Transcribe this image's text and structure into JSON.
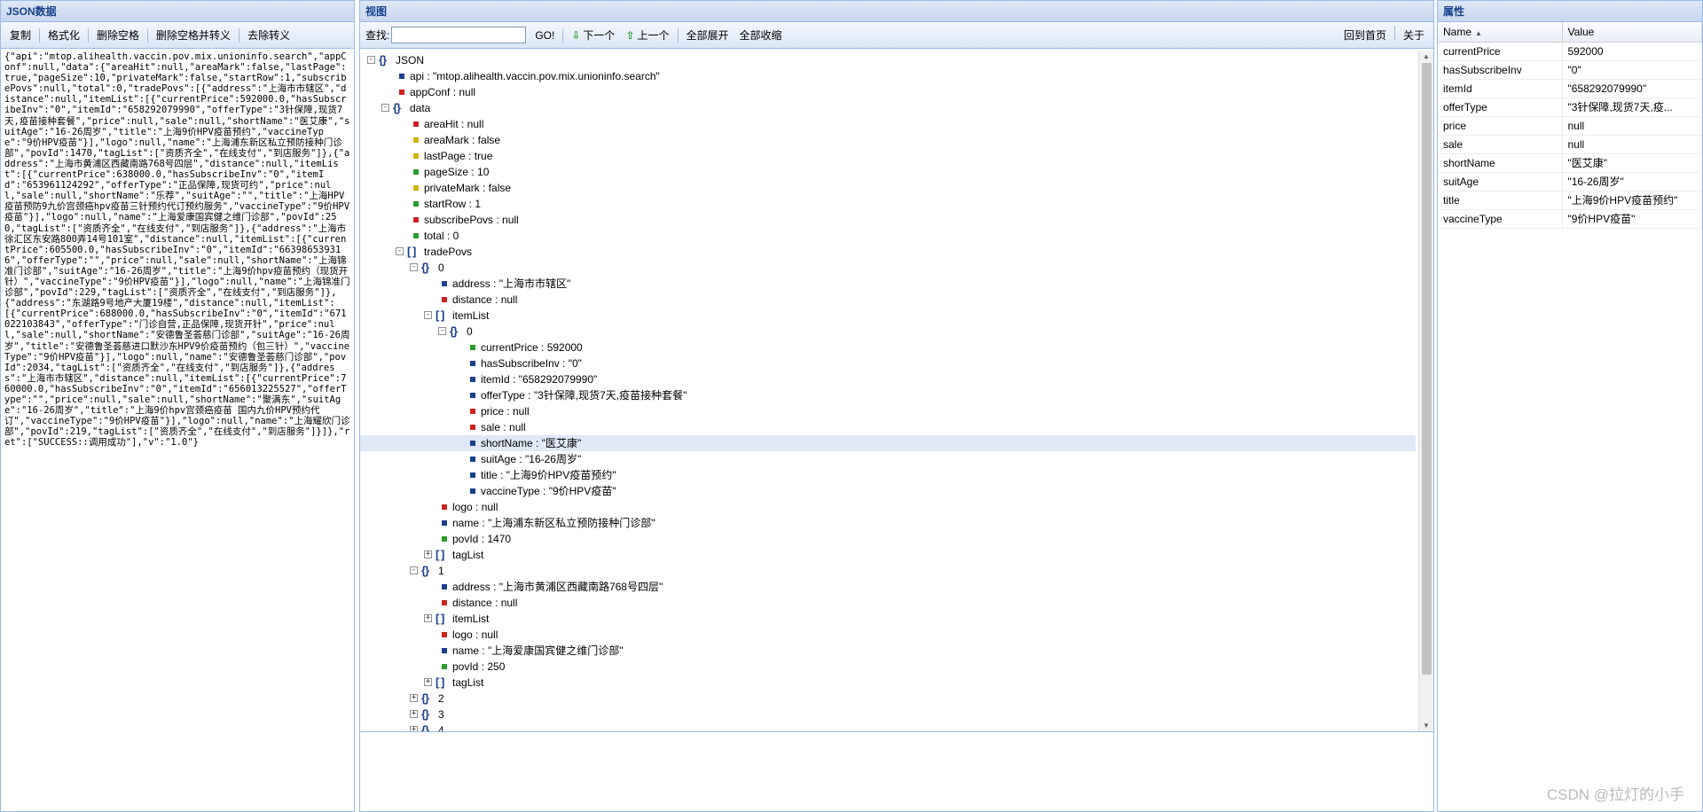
{
  "left_panel": {
    "title": "JSON数据",
    "toolbar": [
      "复制",
      "格式化",
      "删除空格",
      "删除空格并转义",
      "去除转义"
    ],
    "json_text": "{\"api\":\"mtop.alihealth.vaccin.pov.mix.unioninfo.search\",\"appConf\":null,\"data\":{\"areaHit\":null,\"areaMark\":false,\"lastPage\":true,\"pageSize\":10,\"privateMark\":false,\"startRow\":1,\"subscribePovs\":null,\"total\":0,\"tradePovs\":[{\"address\":\"上海市市辖区\",\"distance\":null,\"itemList\":[{\"currentPrice\":592000.0,\"hasSubscribeInv\":\"0\",\"itemId\":\"658292079990\",\"offerType\":\"3针保障,现货7天,疫苗接种套餐\",\"price\":null,\"sale\":null,\"shortName\":\"医艾康\",\"suitAge\":\"16-26周岁\",\"title\":\"上海9价HPV疫苗预约\",\"vaccineType\":\"9价HPV疫苗\"}],\"logo\":null,\"name\":\"上海浦东新区私立预防接种门诊部\",\"povId\":1470,\"tagList\":[\"资质齐全\",\"在线支付\",\"到店服务\"]},{\"address\":\"上海市黄浦区西藏南路768号四层\",\"distance\":null,\"itemList\":[{\"currentPrice\":638000.0,\"hasSubscribeInv\":\"0\",\"itemId\":\"653961124292\",\"offerType\":\"正品保障,现货可约\",\"price\":null,\"sale\":null,\"shortName\":\"乐荐\",\"suitAge\":\"\",\"title\":\"上海HPV疫苗预防9九价宫颈癌hpv疫苗三针预约代订预约服务\",\"vaccineType\":\"9价HPV疫苗\"}],\"logo\":null,\"name\":\"上海爱康国宾健之维门诊部\",\"povId\":250,\"tagList\":[\"资质齐全\",\"在线支付\",\"到店服务\"]},{\"address\":\"上海市徐汇区东安路800弄14号101室\",\"distance\":null,\"itemList\":[{\"currentPrice\":605500.0,\"hasSubscribeInv\":\"0\",\"itemId\":\"663986539316\",\"offerType\":\"\",\"price\":null,\"sale\":null,\"shortName\":\"上海锦准门诊部\",\"suitAge\":\"16-26周岁\",\"title\":\"上海9价hpv疫苗预约（现货开针）\",\"vaccineType\":\"9价HPV疫苗\"}],\"logo\":null,\"name\":\"上海锦准门诊部\",\"povId\":229,\"tagList\":[\"资质齐全\",\"在线支付\",\"到店服务\"]},{\"address\":\"东湖路9号地产大厦19楼\",\"distance\":null,\"itemList\":[{\"currentPrice\":688000.0,\"hasSubscribeInv\":\"0\",\"itemId\":\"671022103843\",\"offerType\":\"门诊自营,正品保障,现货开针\",\"price\":null,\"sale\":null,\"shortName\":\"安德鲁圣荟慈门诊部\",\"suitAge\":\"16-26周岁\",\"title\":\"安德鲁圣荟慈进口默沙东HPV9价疫苗预约（包三针）\",\"vaccineType\":\"9价HPV疫苗\"}],\"logo\":null,\"name\":\"安德鲁圣荟慈门诊部\",\"povId\":2034,\"tagList\":[\"资质齐全\",\"在线支付\",\"到店服务\"]},{\"address\":\"上海市市辖区\",\"distance\":null,\"itemList\":[{\"currentPrice\":760000.0,\"hasSubscribeInv\":\"0\",\"itemId\":\"656013225527\",\"offerType\":\"\",\"price\":null,\"sale\":null,\"shortName\":\"聚满东\",\"suitAge\":\"16-26周岁\",\"title\":\"上海9价hpv宫颈癌疫苗 国内九价HPV预约代订\",\"vaccineType\":\"9价HPV疫苗\"}],\"logo\":null,\"name\":\"上海耀欣门诊部\",\"povId\":219,\"tagList\":[\"资质齐全\",\"在线支付\",\"到店服务\"]}]},\"ret\":[\"SUCCESS::调用成功\"],\"v\":\"1.0\"}"
  },
  "view_panel": {
    "title": "视图",
    "find_label": "查找:",
    "find_value": "",
    "go_label": "GO!",
    "next_label": "下一个",
    "prev_label": "上一个",
    "expand_all": "全部展开",
    "collapse_all": "全部收缩",
    "home": "回到首页",
    "about": "关于"
  },
  "tree": [
    {
      "depth": 0,
      "kind": "object",
      "label": "JSON",
      "toggle": "-"
    },
    {
      "depth": 1,
      "kind": "leaf",
      "color": "#1a3f8f",
      "label": "api : \"mtop.alihealth.vaccin.pov.mix.unioninfo.search\""
    },
    {
      "depth": 1,
      "kind": "leaf",
      "color": "#cc2222",
      "label": "appConf : null"
    },
    {
      "depth": 1,
      "kind": "object",
      "label": "data",
      "toggle": "-"
    },
    {
      "depth": 2,
      "kind": "leaf",
      "color": "#cc2222",
      "label": "areaHit : null"
    },
    {
      "depth": 2,
      "kind": "leaf",
      "color": "#d6b40a",
      "label": "areaMark : false"
    },
    {
      "depth": 2,
      "kind": "leaf",
      "color": "#d6b40a",
      "label": "lastPage : true"
    },
    {
      "depth": 2,
      "kind": "leaf",
      "color": "#2a9d2a",
      "label": "pageSize : 10"
    },
    {
      "depth": 2,
      "kind": "leaf",
      "color": "#d6b40a",
      "label": "privateMark : false"
    },
    {
      "depth": 2,
      "kind": "leaf",
      "color": "#2a9d2a",
      "label": "startRow : 1"
    },
    {
      "depth": 2,
      "kind": "leaf",
      "color": "#cc2222",
      "label": "subscribePovs : null"
    },
    {
      "depth": 2,
      "kind": "leaf",
      "color": "#2a9d2a",
      "label": "total : 0"
    },
    {
      "depth": 2,
      "kind": "array",
      "label": "tradePovs",
      "toggle": "-"
    },
    {
      "depth": 3,
      "kind": "object",
      "label": "0",
      "toggle": "-"
    },
    {
      "depth": 4,
      "kind": "leaf",
      "color": "#1a3f8f",
      "label": "address : \"上海市市辖区\""
    },
    {
      "depth": 4,
      "kind": "leaf",
      "color": "#cc2222",
      "label": "distance : null"
    },
    {
      "depth": 4,
      "kind": "array",
      "label": "itemList",
      "toggle": "-"
    },
    {
      "depth": 5,
      "kind": "object",
      "label": "0",
      "toggle": "-"
    },
    {
      "depth": 6,
      "kind": "leaf",
      "color": "#2a9d2a",
      "label": "currentPrice : 592000"
    },
    {
      "depth": 6,
      "kind": "leaf",
      "color": "#1a3f8f",
      "label": "hasSubscribeInv : \"0\""
    },
    {
      "depth": 6,
      "kind": "leaf",
      "color": "#1a3f8f",
      "label": "itemId : \"658292079990\""
    },
    {
      "depth": 6,
      "kind": "leaf",
      "color": "#1a3f8f",
      "label": "offerType : \"3针保障,现货7天,疫苗接种套餐\""
    },
    {
      "depth": 6,
      "kind": "leaf",
      "color": "#cc2222",
      "label": "price : null"
    },
    {
      "depth": 6,
      "kind": "leaf",
      "color": "#cc2222",
      "label": "sale : null"
    },
    {
      "depth": 6,
      "kind": "leaf",
      "color": "#1a3f8f",
      "label": "shortName : \"医艾康\"",
      "selected": true
    },
    {
      "depth": 6,
      "kind": "leaf",
      "color": "#1a3f8f",
      "label": "suitAge : \"16-26周岁\""
    },
    {
      "depth": 6,
      "kind": "leaf",
      "color": "#1a3f8f",
      "label": "title : \"上海9价HPV疫苗预约\""
    },
    {
      "depth": 6,
      "kind": "leaf",
      "color": "#1a3f8f",
      "label": "vaccineType : \"9价HPV疫苗\""
    },
    {
      "depth": 4,
      "kind": "leaf",
      "color": "#cc2222",
      "label": "logo : null"
    },
    {
      "depth": 4,
      "kind": "leaf",
      "color": "#1a3f8f",
      "label": "name : \"上海浦东新区私立预防接种门诊部\""
    },
    {
      "depth": 4,
      "kind": "leaf",
      "color": "#2a9d2a",
      "label": "povId : 1470"
    },
    {
      "depth": 4,
      "kind": "array",
      "label": "tagList",
      "toggle": "+"
    },
    {
      "depth": 3,
      "kind": "object",
      "label": "1",
      "toggle": "-"
    },
    {
      "depth": 4,
      "kind": "leaf",
      "color": "#1a3f8f",
      "label": "address : \"上海市黄浦区西藏南路768号四层\""
    },
    {
      "depth": 4,
      "kind": "leaf",
      "color": "#cc2222",
      "label": "distance : null"
    },
    {
      "depth": 4,
      "kind": "array",
      "label": "itemList",
      "toggle": "+"
    },
    {
      "depth": 4,
      "kind": "leaf",
      "color": "#cc2222",
      "label": "logo : null"
    },
    {
      "depth": 4,
      "kind": "leaf",
      "color": "#1a3f8f",
      "label": "name : \"上海爱康国宾健之维门诊部\""
    },
    {
      "depth": 4,
      "kind": "leaf",
      "color": "#2a9d2a",
      "label": "povId : 250"
    },
    {
      "depth": 4,
      "kind": "array",
      "label": "tagList",
      "toggle": "+"
    },
    {
      "depth": 3,
      "kind": "object",
      "label": "2",
      "toggle": "+"
    },
    {
      "depth": 3,
      "kind": "object",
      "label": "3",
      "toggle": "+"
    },
    {
      "depth": 3,
      "kind": "object",
      "label": "4",
      "toggle": "+"
    }
  ],
  "props_panel": {
    "title": "属性",
    "col_name": "Name",
    "col_value": "Value",
    "rows": [
      {
        "name": "currentPrice",
        "value": "592000"
      },
      {
        "name": "hasSubscribeInv",
        "value": "\"0\""
      },
      {
        "name": "itemId",
        "value": "\"658292079990\""
      },
      {
        "name": "offerType",
        "value": "\"3针保障,现货7天,疫..."
      },
      {
        "name": "price",
        "value": "null"
      },
      {
        "name": "sale",
        "value": "null"
      },
      {
        "name": "shortName",
        "value": "\"医艾康\""
      },
      {
        "name": "suitAge",
        "value": "\"16-26周岁\""
      },
      {
        "name": "title",
        "value": "\"上海9价HPV疫苗预约\""
      },
      {
        "name": "vaccineType",
        "value": "\"9价HPV疫苗\""
      }
    ]
  },
  "watermark": "CSDN @拉灯的小手"
}
